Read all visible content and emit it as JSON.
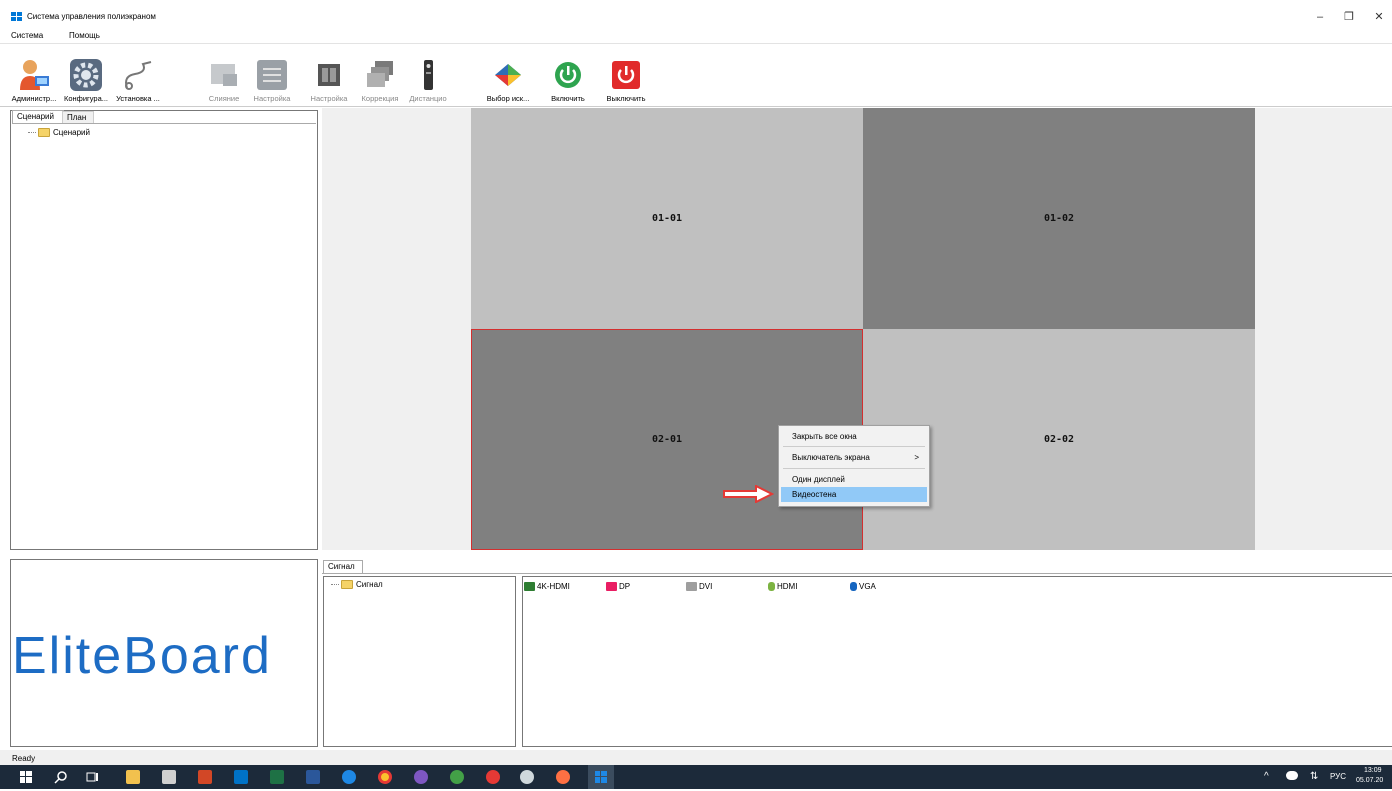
{
  "window": {
    "title": "Система управления полиэкраном",
    "controls": [
      "–",
      "❐",
      "✕"
    ]
  },
  "menu": [
    "Система",
    "Помощь"
  ],
  "toolbar": [
    {
      "label": "Администр...",
      "icon": "admin-user-icon",
      "enabled": true
    },
    {
      "label": "Конфигура...",
      "icon": "config-gear-icon",
      "enabled": true
    },
    {
      "label": "Установка ...",
      "icon": "setup-cable-icon",
      "enabled": true
    },
    {
      "label": "Слияние",
      "icon": "merge-icon",
      "enabled": false
    },
    {
      "label": "Настройка",
      "icon": "settings-sliders-icon",
      "enabled": false
    },
    {
      "label": "Настройка",
      "icon": "settings-wall-icon",
      "enabled": false
    },
    {
      "label": "Коррекция",
      "icon": "correction-icon",
      "enabled": false
    },
    {
      "label": "Дистанцио",
      "icon": "remote-icon",
      "enabled": false
    },
    {
      "label": "Выбор иск...",
      "icon": "source-select-icon",
      "enabled": true
    },
    {
      "label": "Включить",
      "icon": "power-on-icon",
      "enabled": true
    },
    {
      "label": "Выключить",
      "icon": "power-off-icon",
      "enabled": true
    }
  ],
  "left_tabs": [
    "Сценарий",
    "План"
  ],
  "scenario_tree": [
    "Сценарий"
  ],
  "tiles": [
    {
      "label": "01-01",
      "color": "#c0c0c0"
    },
    {
      "label": "01-02",
      "color": "#808080"
    },
    {
      "label": "02-01",
      "color": "#808080",
      "selected": true
    },
    {
      "label": "02-02",
      "color": "#c0c0c0"
    }
  ],
  "context_menu": {
    "items": [
      {
        "label": "Закрыть все окна"
      },
      {
        "label": "Выключатель экрана",
        "submenu": ">"
      },
      {
        "label": "Один дисплей"
      },
      {
        "label": "Видеостена",
        "highlighted": true
      }
    ]
  },
  "logo": "EliteBoard",
  "signal_tab": "Сигнал",
  "signal_tree": [
    "Сигнал"
  ],
  "signals": [
    {
      "label": "4K-HDMI",
      "icon": "sdi-icon",
      "color": "#2e7d32"
    },
    {
      "label": "DP",
      "icon": "dp-icon",
      "color": "#e91e63"
    },
    {
      "label": "DVI",
      "icon": "dvi-icon",
      "color": "#9e9e9e"
    },
    {
      "label": "HDMI",
      "icon": "hdmi-icon",
      "color": "#7cb342"
    },
    {
      "label": "VGA",
      "icon": "vga-icon",
      "color": "#1565c0"
    }
  ],
  "status": "Ready",
  "tray": {
    "lang": "РУС",
    "time": "13:09",
    "date": "05.07.20"
  }
}
